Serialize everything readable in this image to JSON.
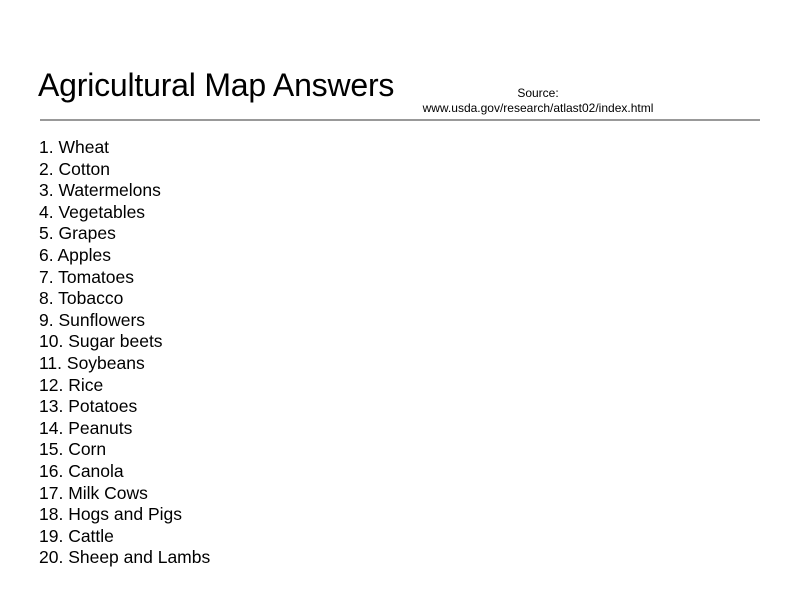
{
  "page": {
    "title": "Agricultural Map Answers",
    "source_label": "Source:",
    "source_url": "www.usda.gov/research/atlast02/index.html",
    "divider_color": "#999999"
  },
  "answers": [
    "1. Wheat",
    "2. Cotton",
    "3. Watermelons",
    "4. Vegetables",
    "5. Grapes",
    "6. Apples",
    "7. Tomatoes",
    "8. Tobacco",
    "9. Sunflowers",
    "10. Sugar beets",
    "11. Soybeans",
    "12. Rice",
    "13. Potatoes",
    "14. Peanuts",
    "15. Corn",
    "16. Canola",
    "17. Milk Cows",
    "18. Hogs and Pigs",
    "19. Cattle",
    "20. Sheep and Lambs"
  ]
}
